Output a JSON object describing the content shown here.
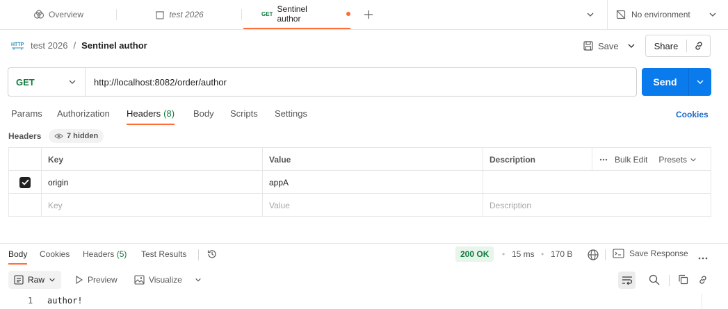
{
  "tabs": [
    {
      "label": "Overview",
      "icon": "overview-icon"
    },
    {
      "label": "test 2026",
      "icon": "collection-icon"
    },
    {
      "method": "GET",
      "label": "Sentinel author",
      "unsaved": true
    }
  ],
  "environment": {
    "label": "No environment"
  },
  "breadcrumb": {
    "parent": "test 2026",
    "separator": "/",
    "current": "Sentinel author"
  },
  "actions": {
    "save": "Save",
    "share": "Share"
  },
  "request": {
    "method": "GET",
    "url": "http://localhost:8082/order/author",
    "send": "Send"
  },
  "request_tabs": [
    {
      "label": "Params"
    },
    {
      "label": "Authorization"
    },
    {
      "label": "Headers",
      "count": "(8)"
    },
    {
      "label": "Body"
    },
    {
      "label": "Scripts"
    },
    {
      "label": "Settings"
    }
  ],
  "cookies_link": "Cookies",
  "headers_section": {
    "label": "Headers",
    "hidden": "7 hidden"
  },
  "table": {
    "columns": [
      "Key",
      "Value",
      "Description"
    ],
    "bulk_edit": "Bulk Edit",
    "presets": "Presets",
    "rows": [
      {
        "key": "origin",
        "value": "appA",
        "description": "",
        "checked": true
      }
    ],
    "placeholder": {
      "key": "Key",
      "value": "Value",
      "description": "Description"
    }
  },
  "response_tabs": [
    {
      "label": "Body"
    },
    {
      "label": "Cookies"
    },
    {
      "label": "Headers",
      "count": "(5)"
    },
    {
      "label": "Test Results"
    }
  ],
  "response_meta": {
    "status": "200 OK",
    "time": "15 ms",
    "size": "170 B",
    "save_response": "Save Response"
  },
  "response_toolbar": {
    "format": "Raw",
    "preview": "Preview",
    "visualize": "Visualize"
  },
  "response_body": [
    {
      "line": "1",
      "text": "author!"
    }
  ],
  "colors": {
    "accent": "#ff6c37",
    "send": "#097bed",
    "method_get": "#0f7b3e",
    "link": "#1b6ac9"
  }
}
